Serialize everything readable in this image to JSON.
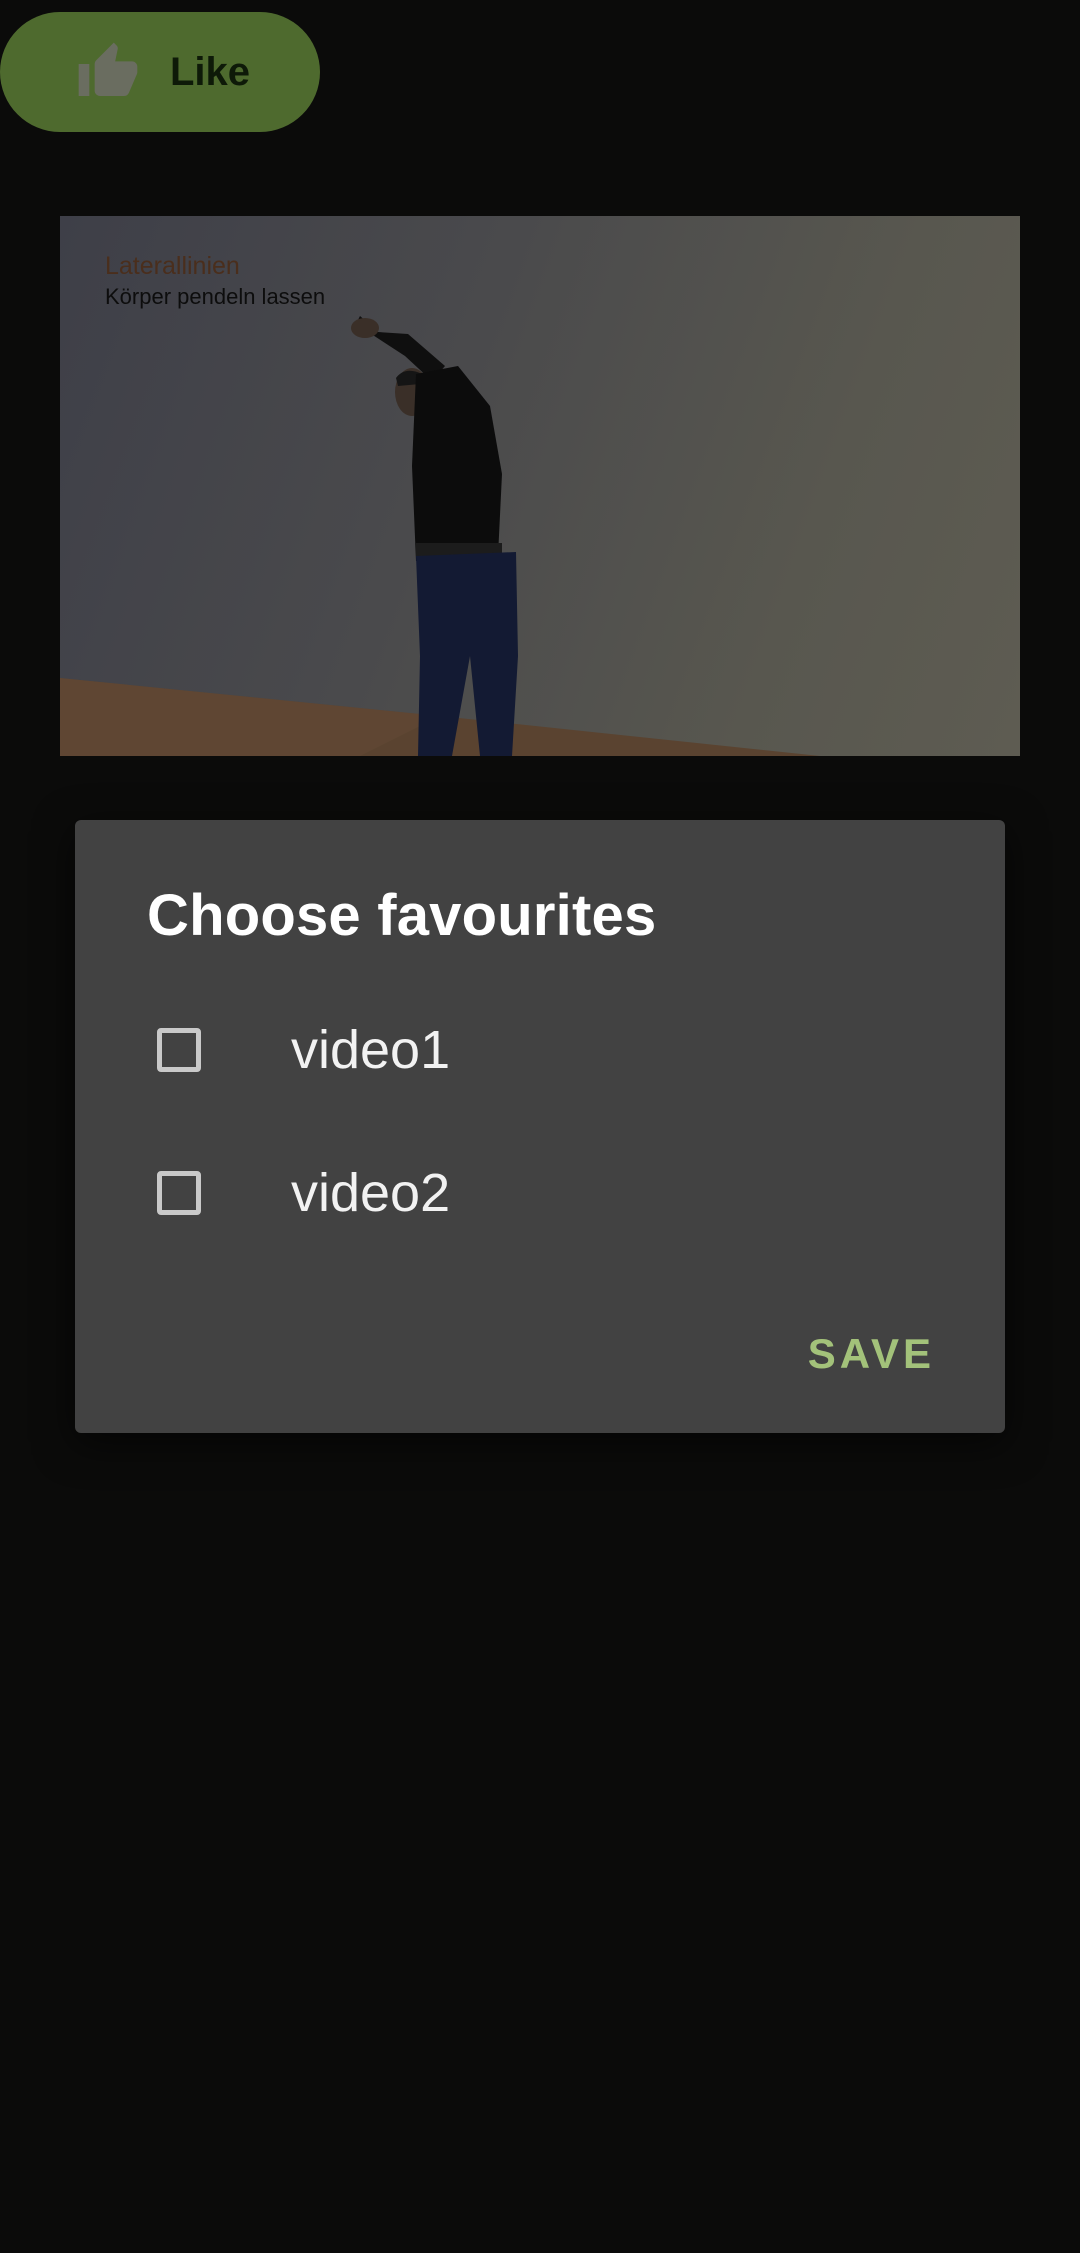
{
  "like_button": {
    "label": "Like",
    "icon": "thumb-up-icon",
    "color": "#4e6a2e"
  },
  "video": {
    "caption_title": "Laterallinien",
    "caption_subtitle": "Körper pendeln lassen"
  },
  "dialog": {
    "title": "Choose favourites",
    "options": [
      {
        "label": "video1",
        "checked": false
      },
      {
        "label": "video2",
        "checked": false
      }
    ],
    "save_label": "SAVE",
    "accent_color": "#a3c27a",
    "background_color": "#424242"
  }
}
